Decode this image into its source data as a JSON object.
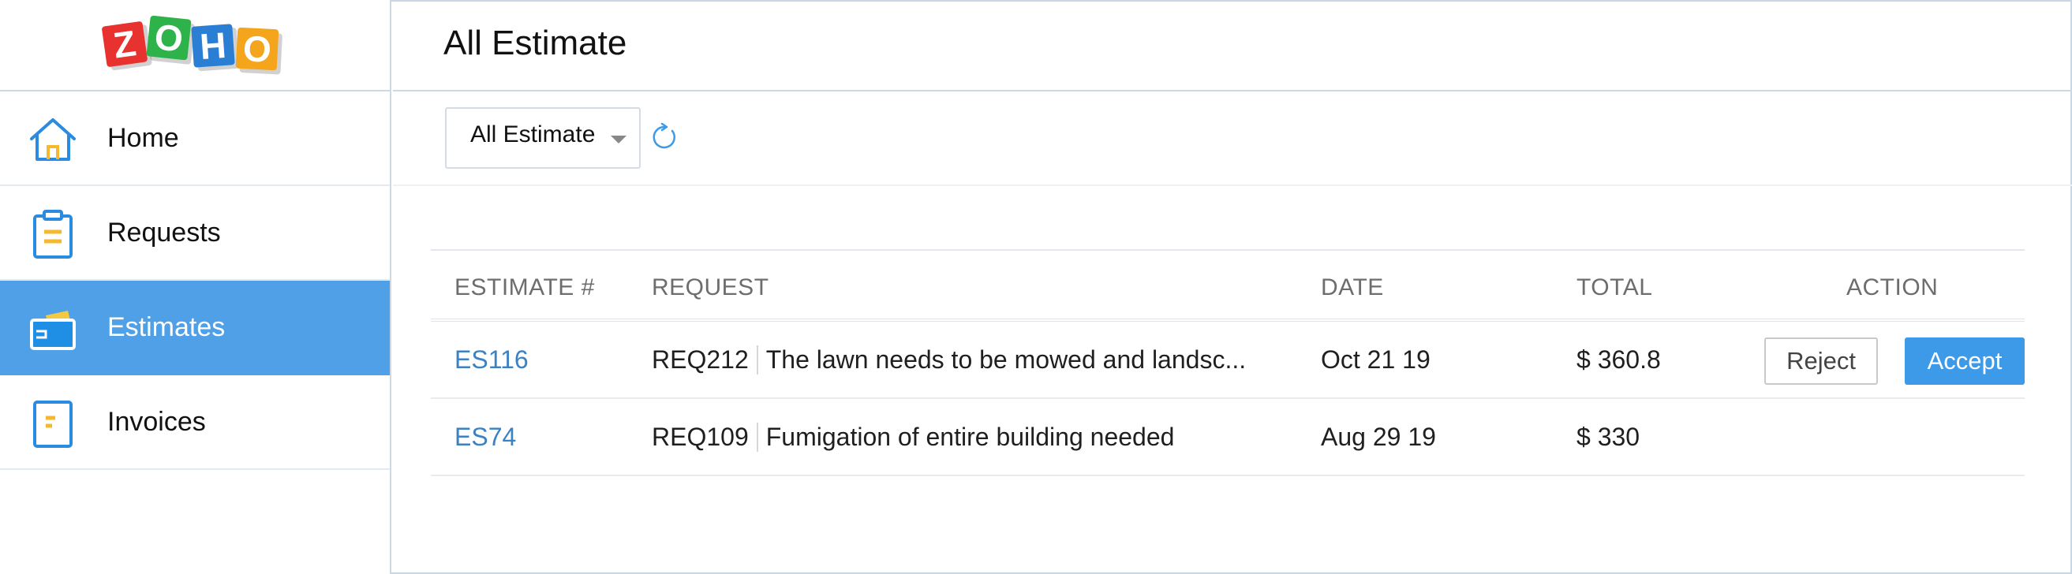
{
  "brand": {
    "logo_letters": [
      "Z",
      "O",
      "H",
      "O"
    ],
    "logo_colors": [
      "#e8322f",
      "#2db34a",
      "#2a7fd4",
      "#f4a51c"
    ]
  },
  "sidebar": {
    "items": [
      {
        "label": "Home",
        "icon": "home-icon",
        "active": false
      },
      {
        "label": "Requests",
        "icon": "clipboard-icon",
        "active": false
      },
      {
        "label": "Estimates",
        "icon": "estimate-card-icon",
        "active": true
      },
      {
        "label": "Invoices",
        "icon": "invoice-document-icon",
        "active": false
      }
    ],
    "active_color": "#4fa0e6"
  },
  "header": {
    "title": "All Estimate"
  },
  "filter": {
    "selected": "All Estimate",
    "refresh_icon": "refresh-icon"
  },
  "table": {
    "columns": {
      "estimate": "ESTIMATE #",
      "request": "REQUEST",
      "date": "DATE",
      "total": "TOTAL",
      "action": "ACTION"
    },
    "rows": [
      {
        "estimate_id": "ES116",
        "request_id": "REQ212",
        "request_desc": "The lawn needs to be mowed and landsc...",
        "date": "Oct 21 19",
        "total": "$ 360.8",
        "reject_label": "Reject",
        "accept_label": "Accept"
      },
      {
        "estimate_id": "ES74",
        "request_id": "REQ109",
        "request_desc": "Fumigation of entire building needed",
        "date": "Aug 29 19",
        "total": "$ 330"
      }
    ]
  },
  "colors": {
    "accent": "#3d9ae8",
    "link": "#3b82c4"
  }
}
